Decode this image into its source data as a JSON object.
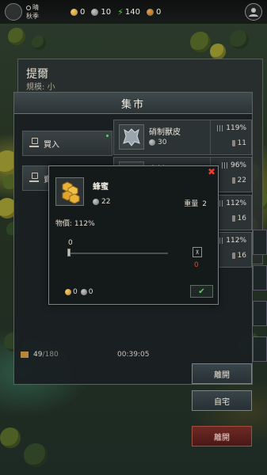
{
  "top_bar": {
    "weather": "晴",
    "season": "秋季",
    "gold": "0",
    "silver": "10",
    "energy": "140",
    "bronze": "0"
  },
  "under_dialog": {
    "title": "提爾",
    "scale_label": "規模:",
    "scale_value": "小"
  },
  "market": {
    "title": "集市",
    "tabs": [
      {
        "label": "買入"
      },
      {
        "label": "賣"
      }
    ],
    "goods": [
      {
        "name": "硝制獸皮",
        "price": "30",
        "price_ratio": "119%",
        "stock": "11"
      },
      {
        "name": "木材",
        "price": "",
        "price_ratio": "96%",
        "stock": "22"
      },
      {
        "name": "",
        "price": "",
        "price_ratio": "112%",
        "stock": "16"
      },
      {
        "name": "",
        "price": "",
        "price_ratio": "112%",
        "stock": "16"
      }
    ],
    "capacity_used": "49",
    "capacity_max": "/180",
    "timer": "00:39:05",
    "leave_label": "離開",
    "home_label": "自宅",
    "leave_red_label": "離開"
  },
  "popup": {
    "item_name": "蜂蜜",
    "price": "22",
    "weight_label": "重量",
    "weight_value": "2",
    "ratio_text": "物價: 112%",
    "quantity": "0",
    "max_value": "0",
    "total_gold": "0",
    "total_silver": "0",
    "close_icon": "close-icon",
    "confirm_icon": "check-icon"
  },
  "colors": {
    "accent_green": "#59d167",
    "close_red": "#ea3c2e",
    "max_red": "#e0463a",
    "panel_bg": "#1a2022"
  }
}
